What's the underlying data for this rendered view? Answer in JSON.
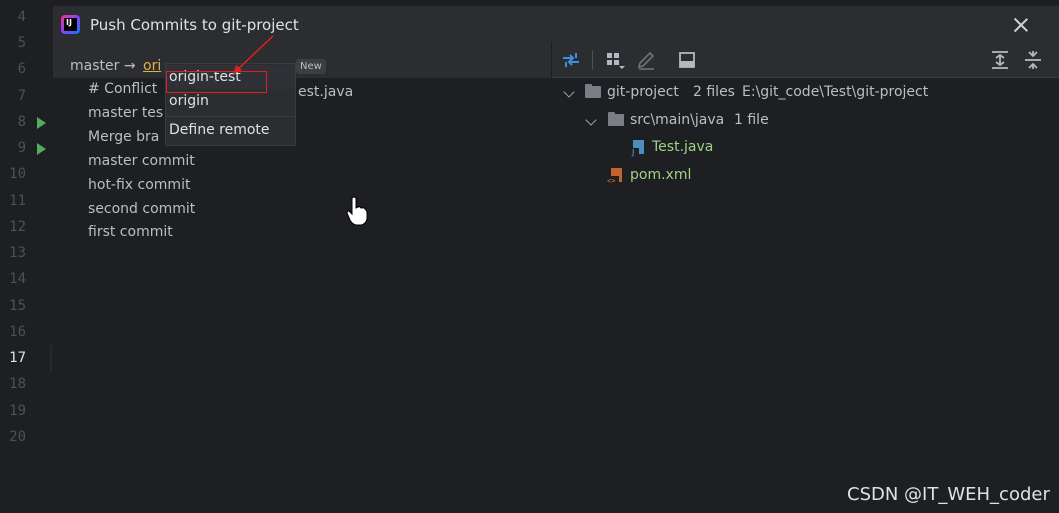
{
  "editor": {
    "line_numbers": [
      "4",
      "5",
      "6",
      "7",
      "8",
      "9",
      "10",
      "11",
      "12",
      "13",
      "14",
      "15",
      "16",
      "17",
      "18",
      "19",
      "20"
    ],
    "current_line": "17"
  },
  "dialog": {
    "title": "Push Commits to git-project",
    "app_icon": "intellij-logo-icon",
    "branch": {
      "source": "master",
      "arrow": "→",
      "target_prefix": "ori",
      "badge": "New"
    },
    "commits": [
      "# Conflict",
      "master tes",
      "Merge bra",
      "master commit",
      "hot-fix commit",
      "second commit",
      "first commit"
    ],
    "commit_truncated_suffix": "est.java",
    "popup": {
      "items": [
        "origin-test",
        "origin"
      ],
      "define_remote": "Define remote",
      "selected": "origin-test"
    },
    "annotation_color": "#e02020"
  },
  "tree": {
    "root": {
      "name": "git-project",
      "count": "2 files",
      "path": "E:\\git_code\\Test\\git-project"
    },
    "folder": {
      "name": "src\\main\\java",
      "count": "1 file"
    },
    "files": [
      {
        "name": "Test.java",
        "icon": "java-file-icon",
        "color": "#9fd286"
      },
      {
        "name": "pom.xml",
        "icon": "maven-xml-icon",
        "color": "#9fd286"
      }
    ]
  },
  "toolbar": {
    "icons": [
      "diff-compare-icon",
      "group-by-icon",
      "edit-icon",
      "show-details-icon",
      "expand-all-icon",
      "collapse-all-icon"
    ]
  },
  "watermark": "CSDN @IT_WEH_coder"
}
